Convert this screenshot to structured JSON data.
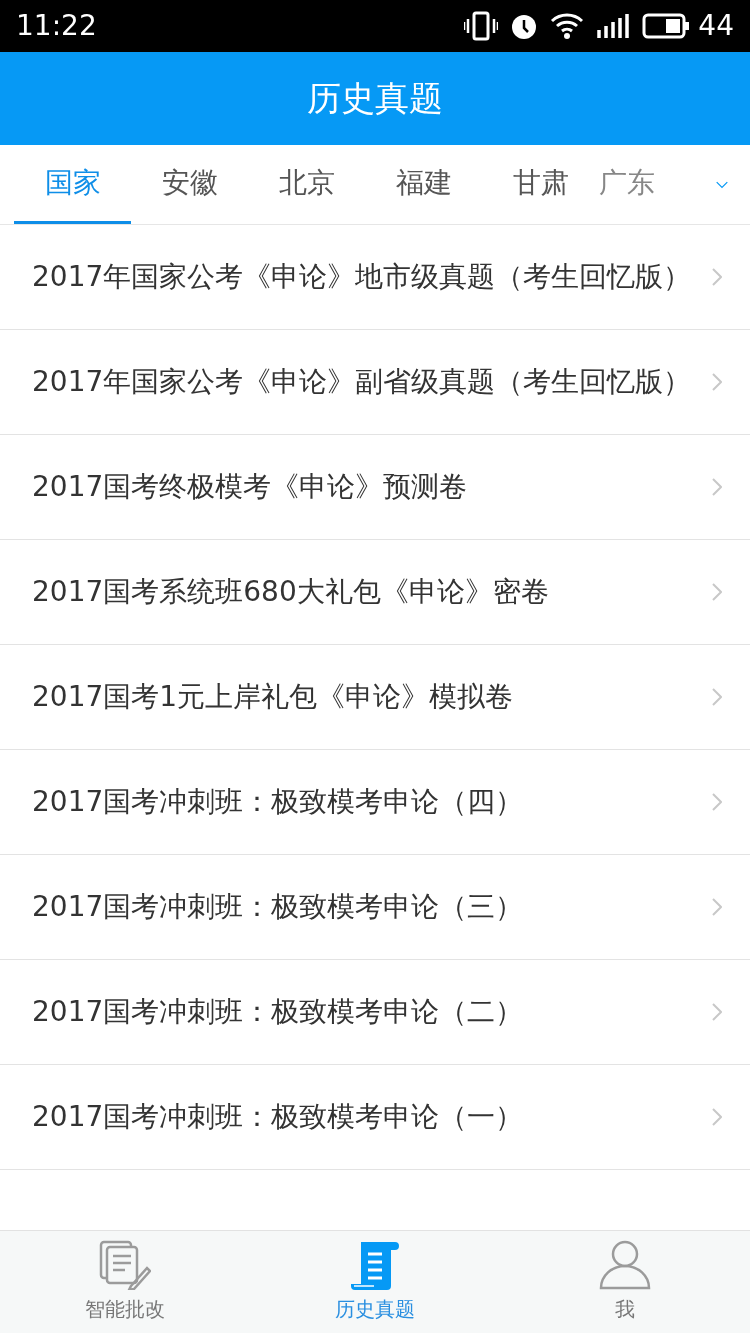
{
  "status_bar": {
    "time": "11:22",
    "battery": "44"
  },
  "header": {
    "title": "历史真题"
  },
  "tabs": [
    {
      "label": "国家",
      "selected": true
    },
    {
      "label": "安徽",
      "selected": false
    },
    {
      "label": "北京",
      "selected": false
    },
    {
      "label": "福建",
      "selected": false
    },
    {
      "label": "甘肃",
      "selected": false
    },
    {
      "label": "广东",
      "selected": false
    }
  ],
  "items": [
    {
      "title": "2017年国家公考《申论》地市级真题（考生回忆版）"
    },
    {
      "title": "2017年国家公考《申论》副省级真题（考生回忆版）"
    },
    {
      "title": "2017国考终极模考《申论》预测卷"
    },
    {
      "title": "2017国考系统班680大礼包《申论》密卷"
    },
    {
      "title": "2017国考1元上岸礼包《申论》模拟卷"
    },
    {
      "title": "2017国考冲刺班：极致模考申论（四）"
    },
    {
      "title": "2017国考冲刺班：极致模考申论（三）"
    },
    {
      "title": "2017国考冲刺班：极致模考申论（二）"
    },
    {
      "title": "2017国考冲刺班：极致模考申论（一）"
    }
  ],
  "bottom_nav": [
    {
      "label": "智能批改",
      "kind": "grading",
      "selected": false
    },
    {
      "label": "历史真题",
      "kind": "scroll",
      "selected": true
    },
    {
      "label": "我",
      "kind": "person",
      "selected": false
    }
  ]
}
